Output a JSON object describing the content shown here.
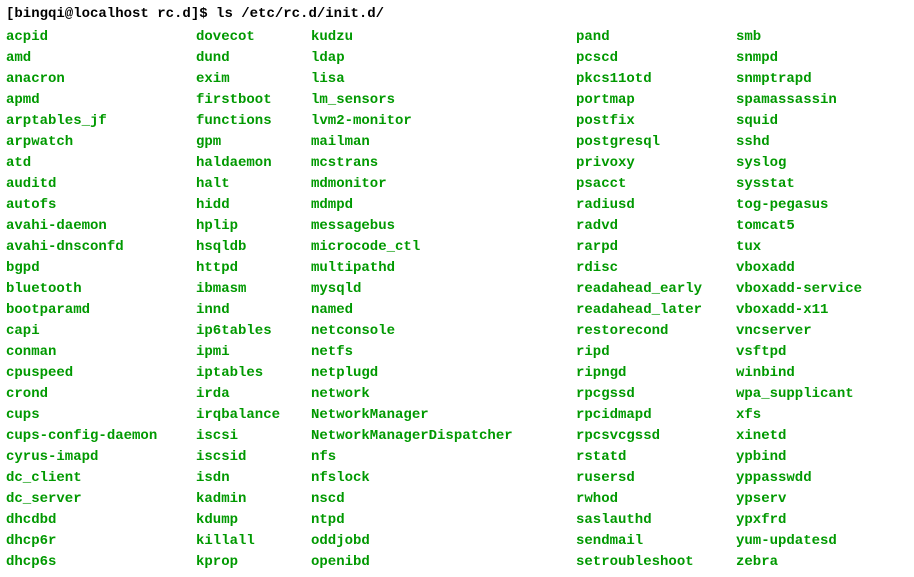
{
  "prompt": {
    "user_host": "[bingqi@localhost rc.d]$",
    "command": "ls /etc/rc.d/init.d/"
  },
  "columns": [
    [
      "acpid",
      "amd",
      "anacron",
      "apmd",
      "arptables_jf",
      "arpwatch",
      "atd",
      "auditd",
      "autofs",
      "avahi-daemon",
      "avahi-dnsconfd",
      "bgpd",
      "bluetooth",
      "bootparamd",
      "capi",
      "conman",
      "cpuspeed",
      "crond",
      "cups",
      "cups-config-daemon",
      "cyrus-imapd",
      "dc_client",
      "dc_server",
      "dhcdbd",
      "dhcp6r",
      "dhcp6s"
    ],
    [
      "dovecot",
      "dund",
      "exim",
      "firstboot",
      "functions",
      "gpm",
      "haldaemon",
      "halt",
      "hidd",
      "hplip",
      "hsqldb",
      "httpd",
      "ibmasm",
      "innd",
      "ip6tables",
      "ipmi",
      "iptables",
      "irda",
      "irqbalance",
      "iscsi",
      "iscsid",
      "isdn",
      "kadmin",
      "kdump",
      "killall",
      "kprop"
    ],
    [
      "kudzu",
      "ldap",
      "lisa",
      "lm_sensors",
      "lvm2-monitor",
      "mailman",
      "mcstrans",
      "mdmonitor",
      "mdmpd",
      "messagebus",
      "microcode_ctl",
      "multipathd",
      "mysqld",
      "named",
      "netconsole",
      "netfs",
      "netplugd",
      "network",
      "NetworkManager",
      "NetworkManagerDispatcher",
      "nfs",
      "nfslock",
      "nscd",
      "ntpd",
      "oddjobd",
      "openibd"
    ],
    [
      "pand",
      "pcscd",
      "pkcs11otd",
      "portmap",
      "postfix",
      "postgresql",
      "privoxy",
      "psacct",
      "radiusd",
      "radvd",
      "rarpd",
      "rdisc",
      "readahead_early",
      "readahead_later",
      "restorecond",
      "ripd",
      "ripngd",
      "rpcgssd",
      "rpcidmapd",
      "rpcsvcgssd",
      "rstatd",
      "rusersd",
      "rwhod",
      "saslauthd",
      "sendmail",
      "setroubleshoot"
    ],
    [
      "smb",
      "snmpd",
      "snmptrapd",
      "spamassassin",
      "squid",
      "sshd",
      "syslog",
      "sysstat",
      "tog-pegasus",
      "tomcat5",
      "tux",
      "vboxadd",
      "vboxadd-service",
      "vboxadd-x11",
      "vncserver",
      "vsftpd",
      "winbind",
      "wpa_supplicant",
      "xfs",
      "xinetd",
      "ypbind",
      "yppasswdd",
      "ypserv",
      "ypxfrd",
      "yum-updatesd",
      "zebra"
    ]
  ]
}
